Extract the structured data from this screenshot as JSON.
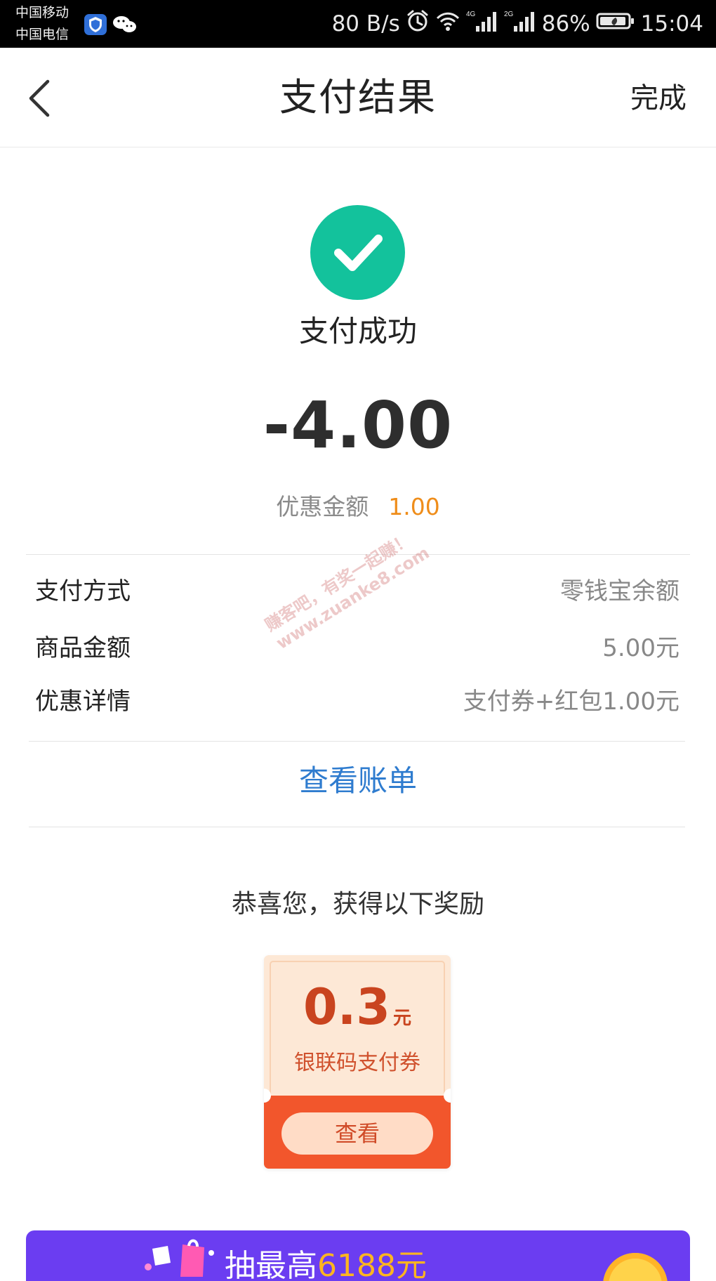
{
  "status_bar": {
    "carrier_1": "中国移动",
    "carrier_2": "中国电信",
    "network_speed": "80 B/s",
    "network_4g": "4G",
    "network_2g": "2G",
    "battery": "86%",
    "time": "15:04"
  },
  "header": {
    "title": "支付结果",
    "done_label": "完成"
  },
  "result": {
    "status_text": "支付成功",
    "amount": "-4.00",
    "discount_label": "优惠金额",
    "discount_value": "1.00"
  },
  "details": [
    {
      "label": "支付方式",
      "value": "零钱宝余额"
    },
    {
      "label": "商品金额",
      "value": "5.00元"
    },
    {
      "label": "优惠详情",
      "value": "支付券+红包1.00元"
    }
  ],
  "links": {
    "view_bill": "查看账单"
  },
  "reward": {
    "title": "恭喜您，获得以下奖励",
    "coupon": {
      "amount": "0.3",
      "unit": "元",
      "name": "银联码支付券",
      "button_label": "查看"
    }
  },
  "promo": {
    "prefix": "抽最高",
    "amount": "6188元"
  },
  "watermark": {
    "line_1": "赚客吧，有奖一起赚！",
    "line_2": "www.zuanke8.com"
  },
  "colors": {
    "success": "#13c29c",
    "discount": "#ef8d1a",
    "link": "#2f7ccf",
    "coupon_red": "#f2562c",
    "promo_purple": "#6b3df1"
  },
  "icons": {
    "security": "security-shield-icon",
    "wechat": "wechat-icon",
    "back": "back-chevron-icon",
    "success": "check-circle-icon"
  }
}
